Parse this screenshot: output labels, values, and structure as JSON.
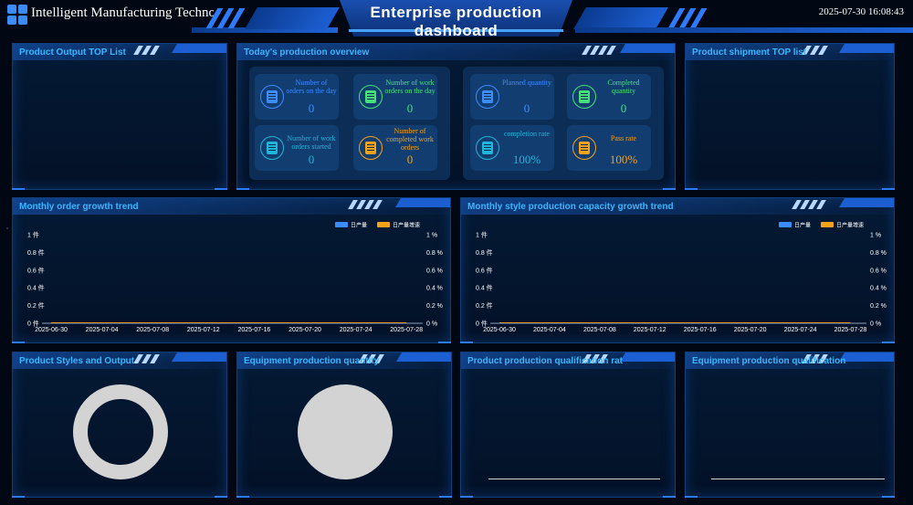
{
  "header": {
    "app_name": "Intelligent Manufacturing Technology",
    "title_line1": "Enterprise production",
    "title_line2": "dashboard",
    "datetime": "2025-07-30 16:08:43"
  },
  "panels": {
    "product_output_top": "Product Output TOP List",
    "overview": "Today's production overview",
    "shipment_top": "Product shipment TOP list",
    "monthly_order": "Monthly order growth trend",
    "monthly_style": "Monthly style production capacity growth trend",
    "styles_output": "Product Styles and Output",
    "equipment_quantity": "Equipment production quantity",
    "qualification_rate": "Product production qualification rat",
    "equipment_qualification": "Equipment production qualification"
  },
  "overview": {
    "cards": [
      {
        "label": "Number of orders on the day",
        "value": "0",
        "color": "#3e8bff"
      },
      {
        "label": "Number of work orders on the day",
        "value": "0",
        "color": "#46e07a"
      },
      {
        "label": "Number of work orders started",
        "value": "0",
        "color": "#1fb6d9"
      },
      {
        "label": "Number of completed work orders",
        "value": "0",
        "color": "#f5a21a"
      },
      {
        "label": "Planned quantity",
        "value": "0",
        "color": "#3e8bff"
      },
      {
        "label": "Completed quantity",
        "value": "0",
        "color": "#46e07a"
      },
      {
        "label": "completion rate",
        "value": "100%",
        "color": "#1fb6d9"
      },
      {
        "label": "Pass rate",
        "value": "100%",
        "color": "#f5a21a"
      }
    ]
  },
  "chart_data": [
    {
      "type": "line",
      "x": [
        "2025-06-30",
        "2025-07-04",
        "2025-07-08",
        "2025-07-12",
        "2025-07-16",
        "2025-07-20",
        "2025-07-24",
        "2025-07-28"
      ],
      "y_left_ticks": [
        "0 件",
        "0.2 件",
        "0.4 件",
        "0.6 件",
        "0.8 件",
        "1 件"
      ],
      "y_right_ticks": [
        "0 %",
        "0.2 %",
        "0.4 %",
        "0.6 %",
        "0.8 %",
        "1 %"
      ],
      "ylim": [
        0,
        1
      ],
      "series": [
        {
          "name": "日产量",
          "color": "#3b8cff",
          "values": [
            0,
            0,
            0,
            0,
            0,
            0,
            0,
            0
          ]
        },
        {
          "name": "日产量增速",
          "color": "#f5a21a",
          "values": [
            0,
            0,
            0,
            0,
            0,
            0,
            0,
            0
          ]
        }
      ],
      "legend": "top-right"
    },
    {
      "type": "line",
      "x": [
        "2025-06-30",
        "2025-07-04",
        "2025-07-08",
        "2025-07-12",
        "2025-07-16",
        "2025-07-20",
        "2025-07-24",
        "2025-07-28"
      ],
      "y_left_ticks": [
        "0 件",
        "0.2 件",
        "0.4 件",
        "0.6 件",
        "0.8 件",
        "1 件"
      ],
      "y_right_ticks": [
        "0 %",
        "0.2 %",
        "0.4 %",
        "0.6 %",
        "0.8 %",
        "1 %"
      ],
      "ylim": [
        0,
        1
      ],
      "series": [
        {
          "name": "日产量",
          "color": "#3b8cff",
          "values": [
            0,
            0,
            0,
            0,
            0,
            0,
            0,
            0
          ]
        },
        {
          "name": "日产量增速",
          "color": "#f5a21a",
          "values": [
            0,
            0,
            0,
            0,
            0,
            0,
            0,
            0
          ]
        }
      ],
      "legend": "top-right"
    }
  ],
  "colors": {
    "accent": "#39b7ff",
    "placeholder": "#d3d3d3"
  }
}
